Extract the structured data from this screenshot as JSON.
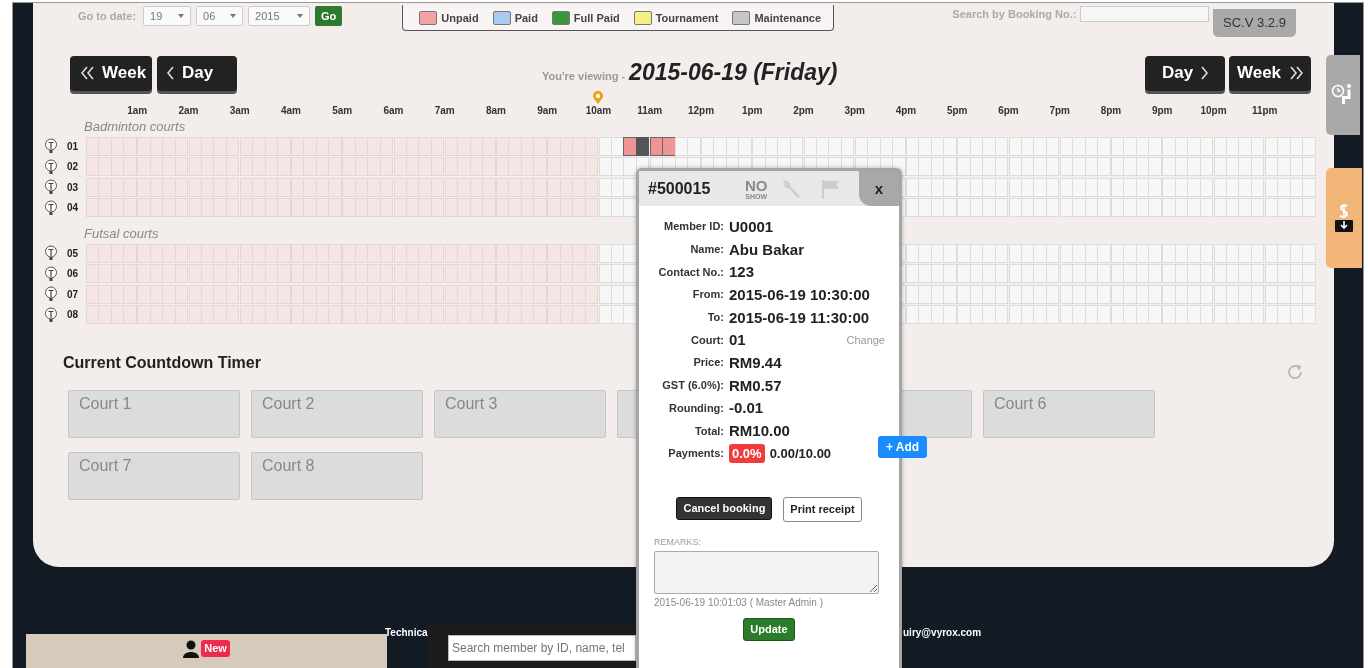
{
  "toolbar": {
    "date_label": "Go to date:",
    "date_selects": [
      "19",
      "06",
      "2015"
    ],
    "go_button": "Go",
    "legend": [
      {
        "label": "Unpaid",
        "color": "#f4a3a3"
      },
      {
        "label": "Paid",
        "color": "#a8cbf0"
      },
      {
        "label": "Full Paid",
        "color": "#3c963c"
      },
      {
        "label": "Tournament",
        "color": "#f6ef86"
      },
      {
        "label": "Maintenance",
        "color": "#c6c6c6"
      }
    ],
    "search_label": "Search by Booking No.:",
    "version": "SC.V 3.2.9"
  },
  "navigation": {
    "prev_week": "Week",
    "prev_day": "Day",
    "viewing_label": "You're viewing -",
    "viewing_date": "2015-06-19 (Friday)",
    "next_day": "Day",
    "next_week": "Week"
  },
  "hours": [
    {
      "label": "1am",
      "current": false
    },
    {
      "label": "2am",
      "current": false
    },
    {
      "label": "3am",
      "current": false
    },
    {
      "label": "4am",
      "current": false
    },
    {
      "label": "5am",
      "current": false
    },
    {
      "label": "6am",
      "current": false
    },
    {
      "label": "7am",
      "current": false
    },
    {
      "label": "8am",
      "current": false
    },
    {
      "label": "9am",
      "current": false
    },
    {
      "label": "10am",
      "current": true
    },
    {
      "label": "11am",
      "current": false
    },
    {
      "label": "12pm",
      "current": false
    },
    {
      "label": "1pm",
      "current": false
    },
    {
      "label": "2pm",
      "current": false
    },
    {
      "label": "3pm",
      "current": false
    },
    {
      "label": "4pm",
      "current": false
    },
    {
      "label": "5pm",
      "current": false
    },
    {
      "label": "6pm",
      "current": false
    },
    {
      "label": "7pm",
      "current": false
    },
    {
      "label": "8pm",
      "current": false
    },
    {
      "label": "9pm",
      "current": false
    },
    {
      "label": "10pm",
      "current": false
    },
    {
      "label": "11pm",
      "current": false
    }
  ],
  "court_groups": [
    {
      "title": "Badminton courts",
      "courts": [
        {
          "number": "01",
          "selected": true
        },
        {
          "number": "02",
          "selected": false
        },
        {
          "number": "03",
          "selected": false
        },
        {
          "number": "04",
          "selected": false
        }
      ]
    },
    {
      "title": "Futsal courts",
      "courts": [
        {
          "number": "05",
          "selected": false
        },
        {
          "number": "06",
          "selected": false
        },
        {
          "number": "07",
          "selected": false
        },
        {
          "number": "08",
          "selected": false
        }
      ]
    }
  ],
  "countdown": {
    "title": "Current Countdown Timer",
    "courts": [
      {
        "kind": "timer",
        "label": "Court 1"
      },
      {
        "kind": "timer",
        "label": "Court 2"
      },
      {
        "kind": "timer",
        "label": "Court 3"
      },
      {
        "kind": "timer"
      },
      {
        "kind": "timer"
      },
      {
        "kind": "timer",
        "label": "Court 6"
      },
      {
        "kind": "timer",
        "label": "Court 7"
      },
      {
        "kind": "timer",
        "label": "Court 8"
      }
    ]
  },
  "booking_popup": {
    "booking_no": "#500015",
    "no_show": "NO",
    "no_show_sub": "SHOW",
    "close": "x",
    "fields": [
      {
        "label": "Member ID:",
        "value": "U0001"
      },
      {
        "label": "Name:",
        "value": "Abu Bakar"
      },
      {
        "label": "Contact No.:",
        "value": "123"
      },
      {
        "label": "From:",
        "value": "2015-06-19 10:30:00"
      },
      {
        "label": "To:",
        "value": "2015-06-19 11:30:00"
      },
      {
        "label": "Court:",
        "value": "01",
        "action": "Change"
      },
      {
        "label": "Price:",
        "value": "RM9.44"
      },
      {
        "label": "GST (6.0%):",
        "value": "RM0.57"
      },
      {
        "label": "Rounding:",
        "value": "-0.01"
      },
      {
        "label": "Total:",
        "value": "RM10.00"
      }
    ],
    "payments": {
      "label": "Payments:",
      "percent": "0.0%",
      "amount": "0.00/10.00",
      "add_button": "+ Add"
    },
    "cancel_button": "Cancel booking",
    "print_button": "Print receipt",
    "remarks_label": "REMARKS:",
    "remarks_log": "2015-06-19 10:01:03 ( Master Admin )",
    "update_button": "Update"
  },
  "footer": {
    "new_badge": "New",
    "text_left": "Technica",
    "search_placeholder": "Search member by ID, name, tel",
    "text_right": "uiry@vyrox.com"
  }
}
